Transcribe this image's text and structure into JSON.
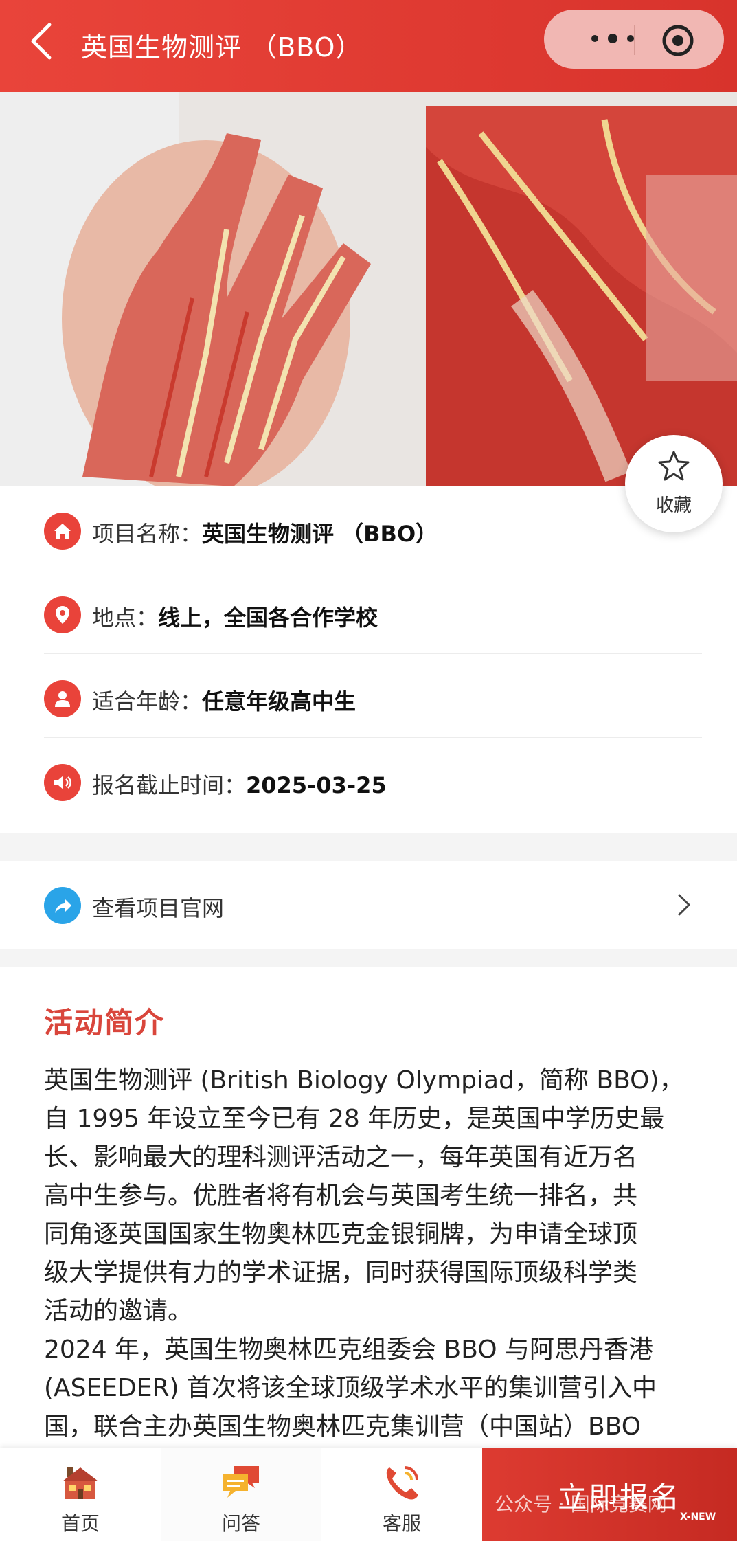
{
  "header": {
    "title": "英国生物测评 （BBO）"
  },
  "favorite": {
    "label": "收藏",
    "icon": "star-icon"
  },
  "info_rows": [
    {
      "icon": "home-icon",
      "label": "项目名称：",
      "value": "英国生物测评 （BBO）"
    },
    {
      "icon": "location-pin-icon",
      "label": "地点：",
      "value": "线上，全国各合作学校"
    },
    {
      "icon": "user-icon",
      "label": "适合年龄：",
      "value": "任意年级高中生"
    },
    {
      "icon": "speaker-icon",
      "label": "报名截止时间：",
      "value": "2025-03-25"
    }
  ],
  "official_site": {
    "label": "查看项目官网",
    "icon": "share-arrow-icon"
  },
  "intro": {
    "heading": "活动简介",
    "lines": [
      "英国生物测评 (British Biology Olympiad，简称 BBO)，",
      "自 1995 年设立至今已有 28 年历史，是英国中学历史最",
      "长、影响最大的理科测评活动之一，每年英国有近万名",
      "高中生参与。优胜者将有机会与英国考生统一排名，共",
      "同角逐英国国家生物奥林匹克金银铜牌，为申请全球顶",
      "级大学提供有力的学术证据，同时获得国际顶级科学类",
      "活动的邀请。",
      "2024 年，英国生物奥林匹克组委会 BBO 与阿思丹香港",
      "(ASEEDER) 首次将该全球顶级学术水平的集训营引入中",
      "国，联合主办英国生物奥林匹克集训营（中国站）BBO"
    ]
  },
  "tabbar": {
    "home": "首页",
    "qa": "问答",
    "service": "客服",
    "signup": "立即报名"
  },
  "watermark": {
    "text": "公众号 · 国际竞赛网",
    "badge": "X-NEW"
  },
  "colors": {
    "brand_red": "#e9433a",
    "link_blue": "#2aa4e8",
    "heading_red": "#d9463c"
  }
}
